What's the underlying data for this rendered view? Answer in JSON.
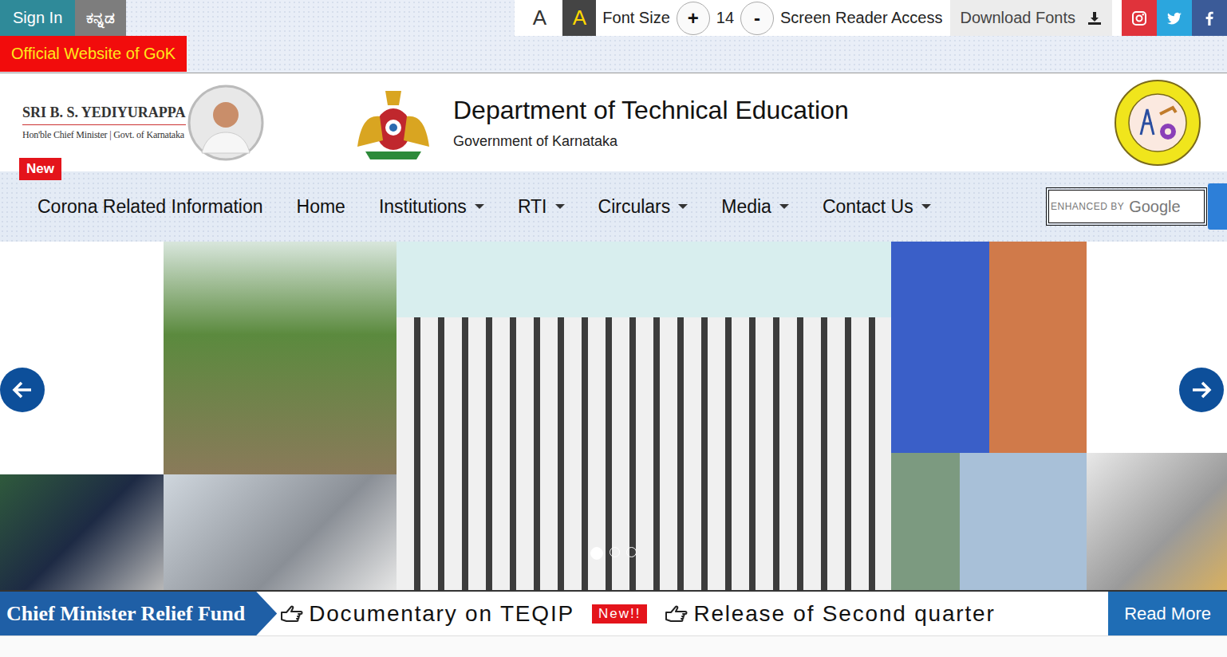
{
  "top_bar": {
    "sign_in": "Sign In",
    "language": "ಕನ್ನಡ",
    "official": "Official Website of GoK",
    "contrast": [
      {
        "label": "A",
        "selected": false
      },
      {
        "label": "A",
        "selected": true
      }
    ],
    "font_size": {
      "label": "Font Size",
      "increase": "+",
      "value": "14",
      "decrease": "-"
    },
    "screen_reader": "Screen Reader Access",
    "download_fonts": "Download Fonts",
    "social": [
      {
        "kind": "instagram",
        "color": "#e0333b"
      },
      {
        "kind": "twitter",
        "color": "#2ba6de"
      },
      {
        "kind": "facebook",
        "color": "#3b5b98"
      }
    ]
  },
  "header": {
    "cm_name": "SRI B. S. YEDIYURAPPA",
    "cm_title": "Hon'ble Chief Minister | Govt. of Karnataka",
    "title": "Department of Technical Education",
    "subtitle": "Government of Karnataka"
  },
  "nav": {
    "items": [
      {
        "label": "Corona Related Information",
        "badge": "New",
        "dropdown": false
      },
      {
        "label": "Home",
        "badge": "",
        "dropdown": false
      },
      {
        "label": "Institutions",
        "badge": "",
        "dropdown": true
      },
      {
        "label": "RTI",
        "badge": "",
        "dropdown": true
      },
      {
        "label": "Circulars",
        "badge": "",
        "dropdown": true
      },
      {
        "label": "Media",
        "badge": "",
        "dropdown": true
      },
      {
        "label": "Contact Us",
        "badge": "",
        "dropdown": true
      }
    ]
  },
  "search": {
    "placeholder_prefix": "ENHANCED BY",
    "placeholder_brand": "Google"
  },
  "carousel": {
    "slides": [
      {
        "selected": true
      },
      {
        "selected": false
      },
      {
        "selected": false
      }
    ]
  },
  "ticker": {
    "label": "Chief Minister Relief Fund",
    "items": [
      {
        "kind": "link",
        "text": "Documentary on TEQIP"
      },
      {
        "kind": "badge",
        "text": "New!!"
      },
      {
        "kind": "link",
        "text": "Release of Second quarter"
      }
    ],
    "read_more": "Read More"
  }
}
